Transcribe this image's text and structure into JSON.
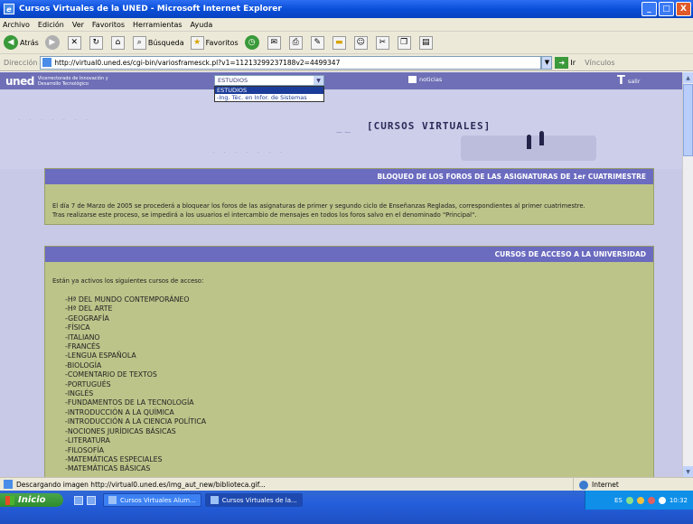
{
  "window": {
    "title": "Cursos Virtuales de la UNED - Microsoft Internet Explorer",
    "min": "_",
    "max": "□",
    "close": "X"
  },
  "menu": [
    "Archivo",
    "Edición",
    "Ver",
    "Favoritos",
    "Herramientas",
    "Ayuda"
  ],
  "toolbar": {
    "back": "Atrás",
    "search": "Búsqueda",
    "favorites": "Favoritos"
  },
  "address": {
    "label": "Dirección",
    "url": "http://virtual0.uned.es/cgi-bin/variosframesck.pl?v1=11213299237188v2=4499347",
    "go": "Ir",
    "links": "Vínculos"
  },
  "site": {
    "logo": "uned",
    "logo_subtitle": "Vicerrectorado de Innovación y Desarrollo Tecnológico",
    "select_value": "ESTUDIOS",
    "select_options": [
      "ESTUDIOS",
      "-Ing. Téc. en Infor. de Sistemas"
    ],
    "news": "noticias",
    "exit": "salir",
    "hero_title": "[CURSOS VIRTUALES]"
  },
  "notice": {
    "heading": "BLOQUEO DE LOS FOROS DE LAS ASIGNATURAS DE 1er CUATRIMESTRE",
    "line1": "El día 7 de Marzo de 2005 se procederá a bloquear los foros de las asignaturas de primer y segundo ciclo de Enseñanzas Regladas, correspondientes al primer cuatrimestre.",
    "line2": "Tras realizarse este proceso, se impedirá a los usuarios el intercambio de mensajes en todos los foros salvo en el denominado \"Principal\"."
  },
  "access": {
    "heading": "CURSOS DE ACCESO A LA UNIVERSIDAD",
    "intro": "Están ya activos los siguientes cursos de acceso:",
    "courses": [
      "-Hª DEL MUNDO CONTEMPORÁNEO",
      "-Hª DEL ARTE",
      "-GEOGRAFÍA",
      "-FÍSICA",
      "-ITALIANO",
      "-FRANCÉS",
      "-LENGUA ESPAÑOLA",
      "-BIOLOGÍA",
      "-COMENTARIO DE TEXTOS",
      "-PORTUGUÉS",
      "-INGLÉS",
      "-FUNDAMENTOS DE LA TECNOLOGÍA",
      "-INTRODUCCIÓN A LA QUÍMICA",
      "-INTRODUCCIÓN A LA CIENCIA POLÍTICA",
      "-NOCIONES JURÍDICAS BÁSICAS",
      "-LITERATURA",
      "-FILOSOFÍA",
      "-MATEMÁTICAS ESPECIALES",
      "-MATEMÁTICAS BÁSICAS"
    ]
  },
  "status": {
    "text": "Descargando imagen http://virtual0.uned.es/img_aut_new/biblioteca.gif...",
    "zone": "Internet"
  },
  "taskbar": {
    "start": "Inicio",
    "task1": "Cursos Virtuales Alum...",
    "task2": "Cursos Virtuales de la...",
    "lang": "ES",
    "clock": "10:32"
  }
}
